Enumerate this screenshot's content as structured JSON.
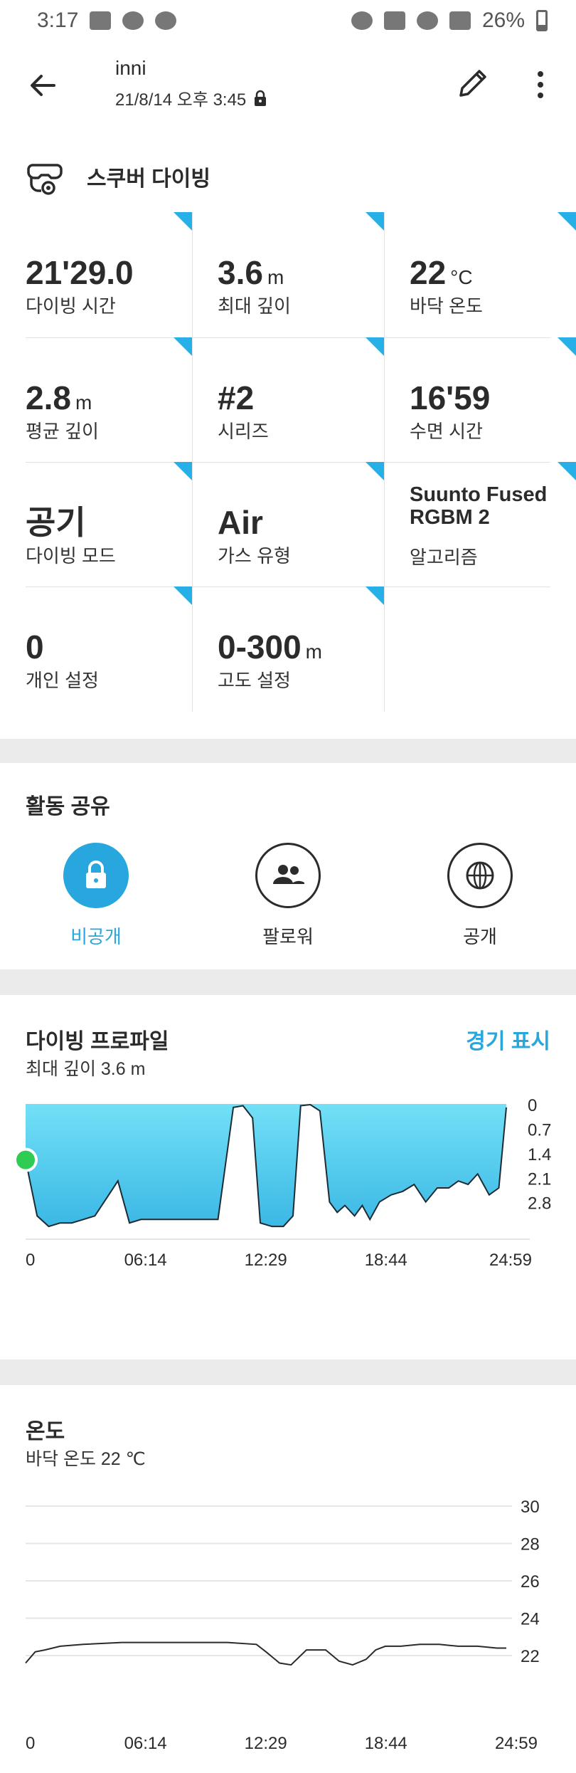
{
  "status_bar": {
    "time": "3:17",
    "battery": "26%"
  },
  "header": {
    "title": "inni",
    "subtitle": "21/8/14 오후 3:45"
  },
  "sport": {
    "name": "스쿠버 다이빙"
  },
  "stats": [
    {
      "value": "21'29.0",
      "unit": "",
      "label": "다이빙 시간"
    },
    {
      "value": "3.6",
      "unit": "m",
      "label": "최대 깊이"
    },
    {
      "value": "22",
      "unit": "°C",
      "label": "바닥 온도"
    },
    {
      "value": "2.8",
      "unit": "m",
      "label": "평균 깊이"
    },
    {
      "value": "#2",
      "unit": "",
      "label": "시리즈"
    },
    {
      "value": "16'59",
      "unit": "",
      "label": "수면 시간"
    },
    {
      "value": "공기",
      "unit": "",
      "label": "다이빙 모드"
    },
    {
      "value": "Air",
      "unit": "",
      "label": "가스 유형"
    },
    {
      "value": "Suunto Fused RGBM 2",
      "unit": "",
      "label": "알고리즘"
    },
    {
      "value": "0",
      "unit": "",
      "label": "개인 설정"
    },
    {
      "value": "0-300",
      "unit": "m",
      "label": "고도 설정"
    }
  ],
  "share": {
    "title": "활동 공유",
    "options": [
      {
        "label": "비공개",
        "icon": "lock-icon",
        "active": true
      },
      {
        "label": "팔로워",
        "icon": "followers-icon",
        "active": false
      },
      {
        "label": "공개",
        "icon": "globe-icon",
        "active": false
      }
    ]
  },
  "colors": {
    "accent": "#27a7dd",
    "corner": "#27b0e8",
    "profile_fill_top": "#72e0f7",
    "profile_fill_bottom": "#3bb8e5",
    "marker": "#2ecc52"
  },
  "profile": {
    "title": "다이빙 프로파일",
    "subtitle": "최대 깊이 3.6 m",
    "link": "경기 표시"
  },
  "temperature": {
    "title": "온도",
    "subtitle": "바닥 온도 22 ℃"
  },
  "chart_data": [
    {
      "type": "area",
      "title": "다이빙 프로파일",
      "x_ticks": [
        "0",
        "06:14",
        "12:29",
        "18:44",
        "24:59"
      ],
      "y_ticks": [
        "0",
        "0.7",
        "1.4",
        "2.1",
        "2.8"
      ],
      "ylim": [
        0,
        3.6
      ],
      "y_inverted": true,
      "x_minutes": [
        0,
        0.6,
        1.2,
        1.8,
        2.4,
        3,
        3.6,
        4.2,
        4.8,
        5.4,
        6,
        6.4,
        6.8,
        7.3,
        8,
        9,
        10,
        10.8,
        11.3,
        11.8,
        12.2,
        12.8,
        13.4,
        13.9,
        14.3,
        14.8,
        15.3,
        15.8,
        16.2,
        16.6,
        17.1,
        17.5,
        17.9,
        18.4,
        19,
        19.6,
        20.2,
        20.8,
        21.4,
        22,
        22.5,
        23,
        23.5,
        24.1,
        24.6,
        24.99
      ],
      "depth_m": [
        1.6,
        3.2,
        3.5,
        3.4,
        3.4,
        3.3,
        3.2,
        2.7,
        2.2,
        3.4,
        3.3,
        3.3,
        3.3,
        3.3,
        3.3,
        3.3,
        3.3,
        0.1,
        0.05,
        0.4,
        3.4,
        3.5,
        3.5,
        3.2,
        0.05,
        0.02,
        0.2,
        2.8,
        3.1,
        2.9,
        3.2,
        2.9,
        3.3,
        2.8,
        2.6,
        2.5,
        2.3,
        2.8,
        2.4,
        2.4,
        2.2,
        2.3,
        2.0,
        2.6,
        2.4,
        0.1
      ],
      "marker": {
        "x_minutes": 0,
        "depth_m": 1.6
      }
    },
    {
      "type": "line",
      "title": "온도",
      "x_ticks": [
        "0",
        "06:14",
        "12:29",
        "18:44",
        "24:59"
      ],
      "y_ticks": [
        "30",
        "28",
        "26",
        "24",
        "22"
      ],
      "ylim": [
        21.2,
        31
      ],
      "x_minutes": [
        0,
        0.5,
        1,
        1.8,
        3,
        5,
        8,
        10.5,
        12,
        12.5,
        13.2,
        13.8,
        14.6,
        15.6,
        16.3,
        17,
        17.7,
        18.2,
        18.7,
        19.5,
        20.5,
        21.5,
        22.5,
        23.5,
        24.5,
        24.99
      ],
      "temp_c": [
        21.6,
        22.2,
        22.3,
        22.5,
        22.6,
        22.7,
        22.7,
        22.7,
        22.6,
        22.2,
        21.6,
        21.5,
        22.3,
        22.3,
        21.7,
        21.5,
        21.8,
        22.3,
        22.5,
        22.5,
        22.6,
        22.6,
        22.5,
        22.5,
        22.4,
        22.4
      ]
    }
  ]
}
